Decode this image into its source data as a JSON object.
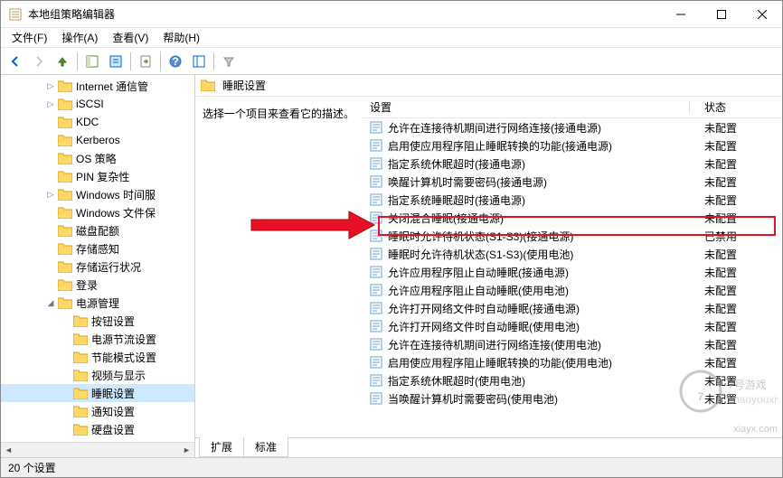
{
  "window": {
    "title": "本地组策略编辑器"
  },
  "menu": {
    "file": "文件(F)",
    "action": "操作(A)",
    "view": "查看(V)",
    "help": "帮助(H)"
  },
  "breadcrumb": {
    "label": "睡眠设置"
  },
  "desc": {
    "text": "选择一个项目来查看它的描述。"
  },
  "columns": {
    "setting": "设置",
    "state": "状态"
  },
  "tree": [
    {
      "label": "Internet 通信管",
      "indent": 63,
      "toggle": ">"
    },
    {
      "label": "iSCSI",
      "indent": 63,
      "toggle": ">"
    },
    {
      "label": "KDC",
      "indent": 63,
      "toggle": ""
    },
    {
      "label": "Kerberos",
      "indent": 63,
      "toggle": ""
    },
    {
      "label": "OS 策略",
      "indent": 63,
      "toggle": ""
    },
    {
      "label": "PIN 复杂性",
      "indent": 63,
      "toggle": ""
    },
    {
      "label": "Windows 时间服",
      "indent": 63,
      "toggle": ">"
    },
    {
      "label": "Windows 文件保",
      "indent": 63,
      "toggle": ""
    },
    {
      "label": "磁盘配额",
      "indent": 63,
      "toggle": ""
    },
    {
      "label": "存储感知",
      "indent": 63,
      "toggle": ""
    },
    {
      "label": "存储运行状况",
      "indent": 63,
      "toggle": ""
    },
    {
      "label": "登录",
      "indent": 63,
      "toggle": ""
    },
    {
      "label": "电源管理",
      "indent": 63,
      "toggle": "v",
      "expanded": true
    },
    {
      "label": "按钮设置",
      "indent": 80,
      "toggle": ""
    },
    {
      "label": "电源节流设置",
      "indent": 80,
      "toggle": ""
    },
    {
      "label": "节能模式设置",
      "indent": 80,
      "toggle": ""
    },
    {
      "label": "视频与显示",
      "indent": 80,
      "toggle": ""
    },
    {
      "label": "睡眠设置",
      "indent": 80,
      "toggle": "",
      "selected": true
    },
    {
      "label": "通知设置",
      "indent": 80,
      "toggle": ""
    },
    {
      "label": "硬盘设置",
      "indent": 80,
      "toggle": ""
    }
  ],
  "settings": [
    {
      "name": "允许在连接待机期间进行网络连接(接通电源)",
      "state": "未配置"
    },
    {
      "name": "启用使应用程序阻止睡眠转换的功能(接通电源)",
      "state": "未配置"
    },
    {
      "name": "指定系统休眠超时(接通电源)",
      "state": "未配置"
    },
    {
      "name": "唤醒计算机时需要密码(接通电源)",
      "state": "未配置"
    },
    {
      "name": "指定系统睡眠超时(接通电源)",
      "state": "未配置"
    },
    {
      "name": "关闭混合睡眠(接通电源)",
      "state": "未配置"
    },
    {
      "name": "睡眠时允许待机状态(S1-S3)(接通电源)",
      "state": "已禁用",
      "highlight": true
    },
    {
      "name": "睡眠时允许待机状态(S1-S3)(使用电池)",
      "state": "未配置"
    },
    {
      "name": "允许应用程序阻止自动睡眠(接通电源)",
      "state": "未配置"
    },
    {
      "name": "允许应用程序阻止自动睡眠(使用电池)",
      "state": "未配置"
    },
    {
      "name": "允许打开网络文件时自动睡眠(接通电源)",
      "state": "未配置"
    },
    {
      "name": "允许打开网络文件时自动睡眠(使用电池)",
      "state": "未配置"
    },
    {
      "name": "允许在连接待机期间进行网络连接(使用电池)",
      "state": "未配置"
    },
    {
      "name": "启用使应用程序阻止睡眠转换的功能(使用电池)",
      "state": "未配置"
    },
    {
      "name": "指定系统休眠超时(使用电池)",
      "state": "未配置"
    },
    {
      "name": "当唤醒计算机时需要密码(使用电池)",
      "state": "未配置"
    }
  ],
  "tabs": {
    "extended": "扩展",
    "standard": "标准"
  },
  "status": {
    "text": "20 个设置"
  },
  "watermark": {
    "url": "xiayx.com",
    "brand": "7号游戏",
    "sub": "zhaoyouxiwang.com"
  }
}
